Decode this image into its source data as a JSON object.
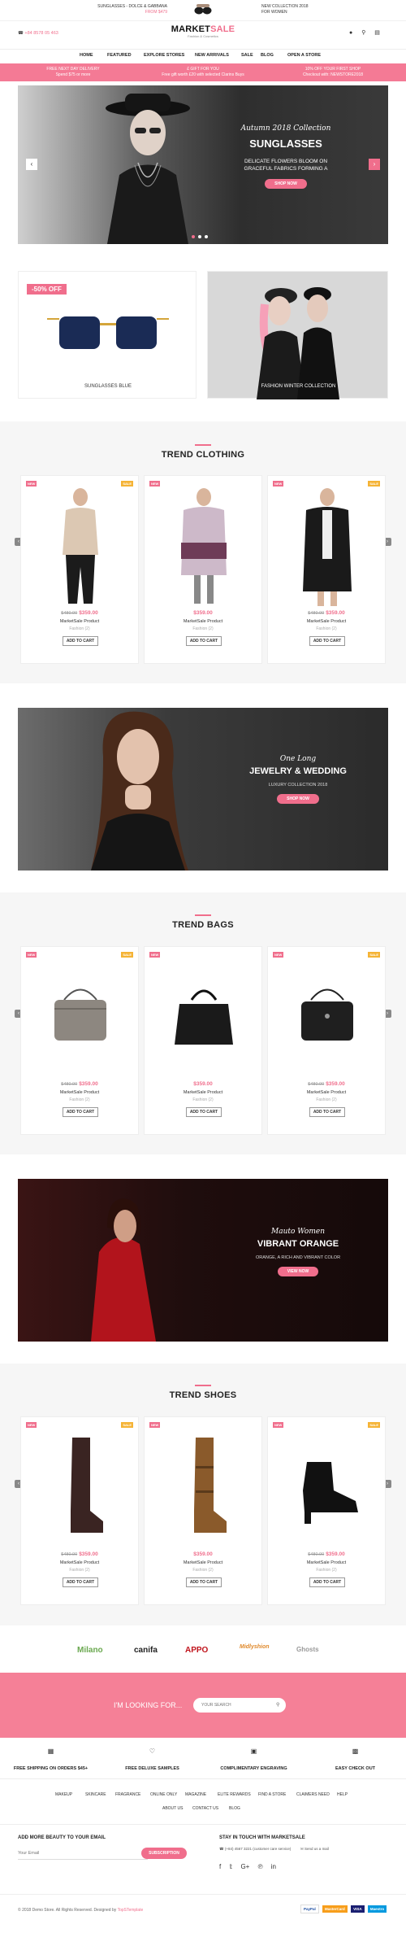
{
  "promo": {
    "left_text": "SUNGLASSES - DOLCE & GABBANA",
    "left_sub": "FROM $479",
    "right_text": "NEW COLLECTION 2018",
    "right_sub": "FOR WOMEN"
  },
  "header": {
    "phone": "+84 8578 05 463",
    "logo_market": "MARKET",
    "logo_sale": "SALE",
    "logo_tagline": "Fashion & Cosmetics"
  },
  "nav": [
    "HOME",
    "FEATURED",
    "EXPLORE STORES",
    "NEW ARRIVALS",
    "SALE",
    "BLOG",
    "OPEN A STORE"
  ],
  "pinkbar": [
    {
      "line1": "FREE NEXT DAY DELIVERY",
      "line2": "Spend $75 or more"
    },
    {
      "line1": "£ GIFT FOR YOU",
      "line2": "Free gift worth £20 with selected Clarins Buys"
    },
    {
      "line1": "10% OFF YOUR FIRST SHOP",
      "line2": "Checkout with: NEWSTORE2018"
    }
  ],
  "hero": {
    "script": "Autumn 2018 Collection",
    "title": "SUNGLASSES",
    "desc1": "DELICATE FLOWERS BLOOM ON",
    "desc2": "GRACEFUL FABRICS FORMING A",
    "button": "SHOP NOW"
  },
  "promos": [
    {
      "badge": "-50% OFF",
      "label": "SUNGLASSES BLUE"
    },
    {
      "label": "FASHION WINTER COLLECTION"
    }
  ],
  "sections": [
    {
      "title": "TREND CLOTHING",
      "products": [
        {
          "old": "$480.00",
          "price": "$359.00",
          "name": "MarketSale Product",
          "cat": "Fashion (2)",
          "button": "ADD TO CART",
          "new": "NEW",
          "sale": "SALE"
        },
        {
          "old": "",
          "price": "$359.00",
          "name": "MarketSale Product",
          "cat": "Fashion (2)",
          "button": "ADD TO CART",
          "new": "NEW",
          "sale": ""
        },
        {
          "old": "$480.00",
          "price": "$359.00",
          "name": "MarketSale Product",
          "cat": "Fashion (2)",
          "button": "ADD TO CART",
          "new": "NEW",
          "sale": "SALE"
        }
      ]
    },
    {
      "title": "TREND BAGS",
      "products": [
        {
          "old": "$480.00",
          "price": "$359.00",
          "name": "MarketSale Product",
          "cat": "Fashion (2)",
          "button": "ADD TO CART",
          "new": "NEW",
          "sale": "SALE"
        },
        {
          "old": "",
          "price": "$359.00",
          "name": "MarketSale Product",
          "cat": "Fashion (2)",
          "button": "ADD TO CART",
          "new": "NEW",
          "sale": ""
        },
        {
          "old": "$480.00",
          "price": "$359.00",
          "name": "MarketSale Product",
          "cat": "Fashion (2)",
          "button": "ADD TO CART",
          "new": "NEW",
          "sale": "SALE"
        }
      ]
    },
    {
      "title": "TREND SHOES",
      "products": [
        {
          "old": "$480.00",
          "price": "$359.00",
          "name": "MarketSale Product",
          "cat": "Fashion (2)",
          "button": "ADD TO CART",
          "new": "NEW",
          "sale": "SALE"
        },
        {
          "old": "",
          "price": "$359.00",
          "name": "MarketSale Product",
          "cat": "Fashion (2)",
          "button": "ADD TO CART",
          "new": "NEW",
          "sale": ""
        },
        {
          "old": "$480.00",
          "price": "$359.00",
          "name": "MarketSale Product",
          "cat": "Fashion (2)",
          "button": "ADD TO CART",
          "new": "NEW",
          "sale": "SALE"
        }
      ]
    }
  ],
  "banner1": {
    "script": "One Long",
    "title": "JEWELRY & WEDDING",
    "sub": "LUXURY COLLECTION 2018",
    "button": "SHOP NOW"
  },
  "banner2": {
    "script": "Mauto Women",
    "title": "VIBRANT ORANGE",
    "sub": "ORANGE, A RICH AND VIBRANT COLOR",
    "button": "VIEW NOW"
  },
  "brands": [
    "Milano",
    "canifa",
    "APPO",
    "Midlyshion",
    "Ghosts"
  ],
  "search": {
    "label": "I'M LOOKING FOR...",
    "placeholder": "YOUR SEARCH"
  },
  "features": [
    "FREE SHIPPING ON ORDERS $45+",
    "FREE DELUXE SAMPLES",
    "COMPLIMENTARY ENGRAVING",
    "EASY CHECK OUT"
  ],
  "footer_links1": [
    "MAKEUP",
    "SKINCARE",
    "FRAGRANCE",
    "ONLINE ONLY",
    "MAGAZINE",
    "ELITE REWARDS",
    "FIND A STORE",
    "CLAIMERS NEED",
    "HELP"
  ],
  "footer_links2": [
    "ABOUT US",
    "CONTACT US",
    "BLOG"
  ],
  "newsletter": {
    "title": "ADD MORE BEAUTY TO YOUR EMAIL",
    "placeholder": "Your Email",
    "button": "SUBSCRIPTION"
  },
  "contact": {
    "title": "STAY IN TOUCH WITH MARKETSALE",
    "phone": "(+84) 4567 3221 (customer care service)",
    "email": "Send us a mail"
  },
  "copyright": "© 2018 Demo Store. All Rights Reserved. Designed by",
  "copyright_link": "TopSTemplate",
  "payments": [
    "PayPal",
    "MasterCard",
    "VISA",
    "Maestro"
  ],
  "colors": {
    "accent": "#f06e8c",
    "sale": "#f5b335"
  }
}
